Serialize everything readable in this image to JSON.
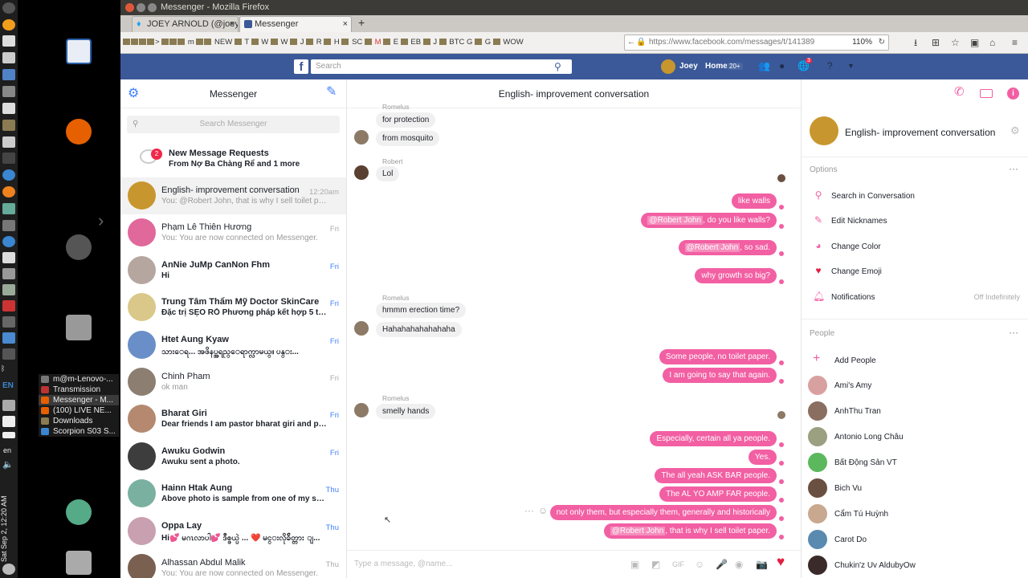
{
  "launcher": {
    "sidebar_text": "Sat Sep 2, 12:20 AM",
    "lang": "EN",
    "lang2": "en"
  },
  "taskmenu": [
    "m@m-Lenovo-...",
    "Transmission",
    "Messenger - M...",
    "(100) LIVE NE...",
    "Downloads",
    "Scorpion S03 S..."
  ],
  "window": {
    "title": "Messenger - Mozilla Firefox"
  },
  "tabs": [
    {
      "label": "JOEY ARNOLD (@joey"
    },
    {
      "label": "Messenger"
    }
  ],
  "bookmarks": [
    "NEW",
    "T",
    "W",
    "W",
    "J",
    "R",
    "H",
    "SC",
    "M",
    "E",
    "EB",
    "J",
    "BTC",
    "G",
    "G",
    "WOW"
  ],
  "url": {
    "text": "https://www.facebook.com/messages/t/141389",
    "zoom": "110%"
  },
  "fb": {
    "search_placeholder": "Search",
    "user": "Joey",
    "home": "Home",
    "home_badge": "20+",
    "notif_count": "3"
  },
  "left": {
    "title": "Messenger",
    "search_placeholder": "Search Messenger",
    "requests": {
      "badge": "2",
      "title": "New Message Requests",
      "subtitle": "From Nợ Ba Chàng Rể and 1 more"
    },
    "conversations": [
      {
        "name": "English- improvement conversation",
        "snippet": "You: @Robert John, that is why I sell toilet paper.",
        "time": "12:20am",
        "unread": false,
        "selected": true,
        "color": "#c8962e"
      },
      {
        "name": "Phạm Lê Thiên Hương",
        "snippet": "You: You are now connected on Messenger.",
        "time": "Fri",
        "unread": false,
        "color": "#e0689a"
      },
      {
        "name": "AnNie JuMp CanNon Fhm",
        "snippet": "Hi",
        "time": "Fri",
        "unread": true,
        "color": "#b5a7a0"
      },
      {
        "name": "Trung Tâm Thẩm Mỹ Doctor SkinCare",
        "snippet": "Đặc trị SẸO RỖ Phương pháp kết hợp 5 tron...",
        "time": "Fri",
        "unread": true,
        "color": "#d9c88a"
      },
      {
        "name": "Htet Aung Kyaw",
        "snippet": "သားေရ... အဖိနပ္အရည္ေရာက္လာမယ္။ ပန္း...",
        "time": "Fri",
        "unread": true,
        "color": "#6a8fc8"
      },
      {
        "name": "Chinh Pham",
        "snippet": "ok man",
        "time": "Fri",
        "unread": false,
        "color": "#8c7f72"
      },
      {
        "name": "Bharat Giri",
        "snippet": "Dear friends I am pastor bharat giri and pre...",
        "time": "Fri",
        "unread": true,
        "color": "#b48970"
      },
      {
        "name": "Awuku Godwin",
        "snippet": "Awuku sent a photo.",
        "time": "Fri",
        "unread": true,
        "color": "#3d3d3d"
      },
      {
        "name": "Hainn Htak Aung",
        "snippet": "Above photo is sample from one of my son...",
        "time": "Thu",
        "unread": true,
        "color": "#7ab0a0"
      },
      {
        "name": "Oppa Lay",
        "snippet": "Hi💕 မဂၤလာပါ💕 ဒီစ္ဖယ္ပဲ ... ❤️ မင္းလိုခ်ိတ္တား ျ...",
        "time": "Thu",
        "unread": true,
        "color": "#c8a0b0"
      },
      {
        "name": "Alhassan Abdul Malik",
        "snippet": "You: You are now connected on Messenger.",
        "time": "Thu",
        "unread": false,
        "color": "#7a6050"
      }
    ]
  },
  "chat": {
    "title": "English- improvement conversation",
    "composer_placeholder": "Type a message, @name...",
    "messages": {
      "top_sender": "Romelus",
      "m1": "for protection",
      "m2": "from mosquito",
      "robert": "Robert",
      "m3": "Lol",
      "m4": "like walls",
      "m5_mention": "@Robert John",
      "m5_rest": ", do you like walls?",
      "m6_mention": "@Robert John",
      "m6_rest": ", so sad.",
      "m7": "why growth so big?",
      "romelus2": "Romelus",
      "m8": "hmmm erection time?",
      "m9": "Hahahahahahahaha",
      "m10": "Some people, no toilet paper.",
      "m11": "I am going to say that again.",
      "romelus3": "Romelus",
      "m12": "smelly hands",
      "m13": "Especially, certain all ya people.",
      "m14": "Yes.",
      "m15": "The all yeah ASK BAR people.",
      "m16": "The AL YO AMP FAR people.",
      "m17": "not only them, but especially them, generally  and historically",
      "m18_mention": "@Robert John",
      "m18_rest": ", that is why I sell toilet paper."
    }
  },
  "right": {
    "title": "English- improvement conversation",
    "options_label": "Options",
    "options": [
      {
        "label": "Search in Conversation",
        "icon": "search-icon"
      },
      {
        "label": "Edit Nicknames",
        "icon": "pencil-icon"
      },
      {
        "label": "Change Color",
        "icon": "palette-icon"
      },
      {
        "label": "Change Emoji",
        "icon": "heart-icon"
      },
      {
        "label": "Notifications",
        "icon": "bell-icon",
        "value": "Off Indefinitely"
      }
    ],
    "people_label": "People",
    "add_people": "Add People",
    "people": [
      {
        "name": "Ami's Amy",
        "color": "#d9a0a0"
      },
      {
        "name": "AnhThu Tran",
        "color": "#8a6e60"
      },
      {
        "name": "Antonio Long Châu",
        "color": "#9aa080"
      },
      {
        "name": "Bất Động Sản VT",
        "color": "#5cb85c"
      },
      {
        "name": "Bich Vu",
        "color": "#6a5040"
      },
      {
        "name": "Cẩm Tú Huỳnh",
        "color": "#c9a890"
      },
      {
        "name": "Carot Do",
        "color": "#5a8ab0"
      },
      {
        "name": "Chukin'z Uv AldubyOw",
        "color": "#3a2a2a"
      }
    ]
  },
  "accent": "#f25fa3",
  "fb_blue": "#3b5998"
}
